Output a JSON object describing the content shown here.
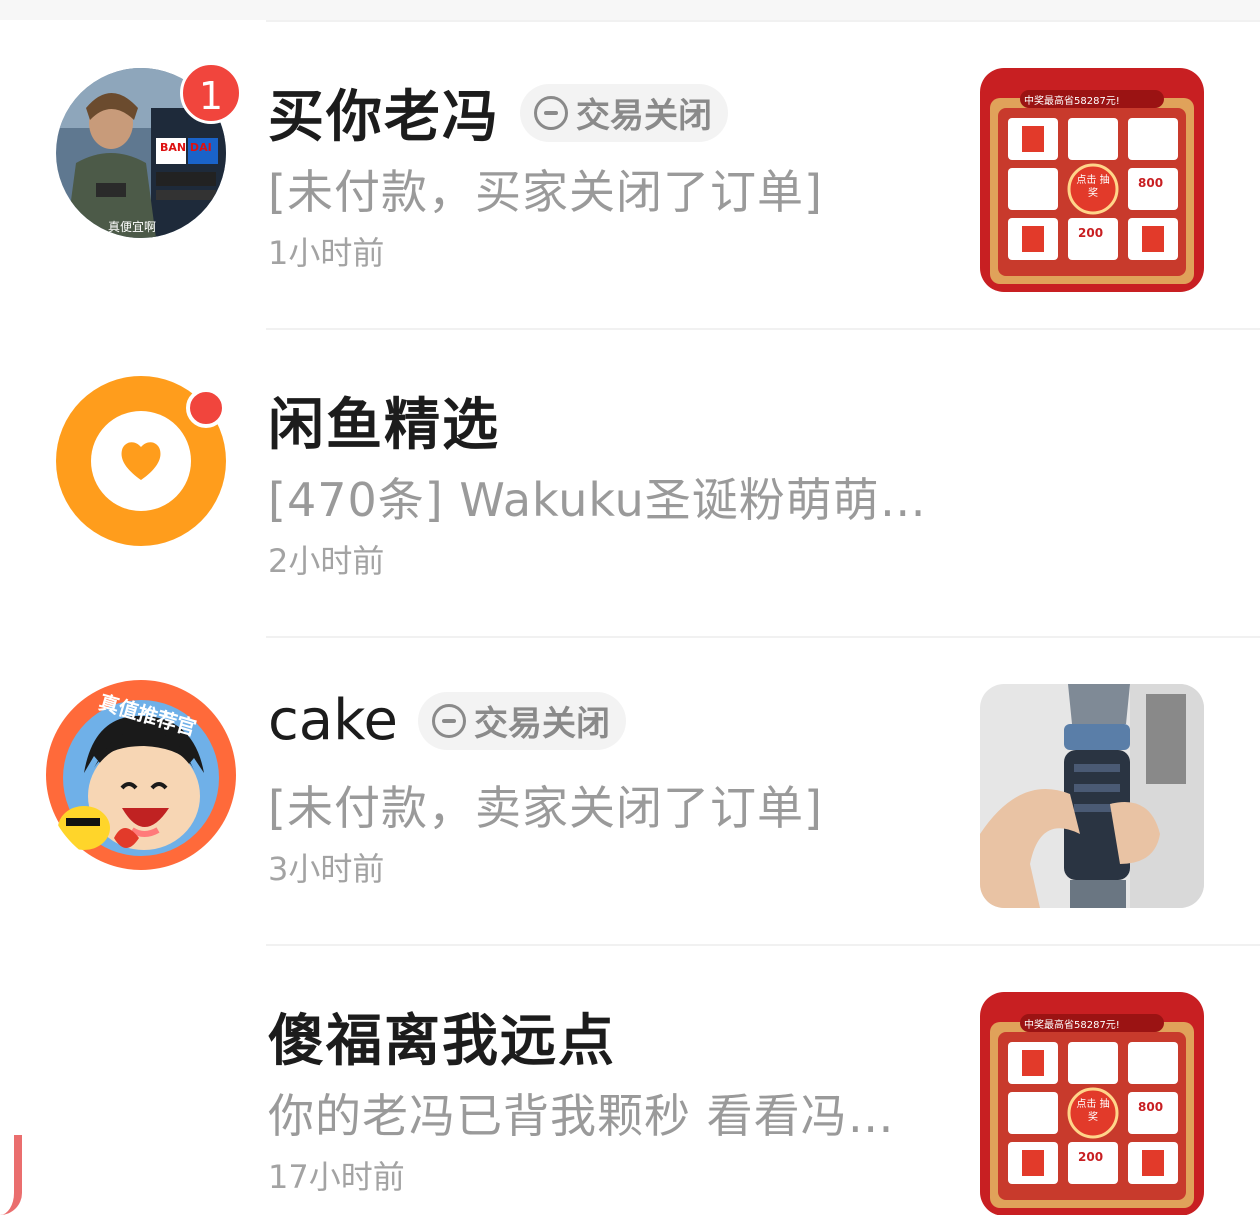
{
  "conversations": [
    {
      "name": "买你老冯",
      "status": "交易关闭",
      "preview": "[未付款，买家关闭了订单]",
      "time": "1小时前",
      "unread_count": "1",
      "avatar_text": {
        "brand": "BAN DAI",
        "caption": "真便宜啊"
      },
      "thumbnail_text": {
        "banner": "中奖最高省58287元!",
        "center": "点击 抽奖",
        "value_a": "800",
        "value_b": "200"
      }
    },
    {
      "name": "闲鱼精选",
      "status": "",
      "preview": "[470条] Wakuku圣诞粉萌萌…",
      "time": "2小时前",
      "unread_dot": true
    },
    {
      "name": "cake",
      "status": "交易关闭",
      "preview": "[未付款，卖家关闭了订单]",
      "time": "3小时前",
      "avatar_text": {
        "arc": "真值推荐官"
      }
    },
    {
      "name": "傻福离我远点",
      "status": "",
      "preview": "你的老冯已背我颗秒 看看冯…",
      "time": "17小时前",
      "thumbnail_text": {
        "banner": "中奖最高省58287元!",
        "center": "点击 抽奖",
        "value_a": "800",
        "value_b": "200"
      }
    }
  ],
  "colors": {
    "badge": "#f1453d",
    "xianyu_orange": "#ff9d1c",
    "name_text": "#1c1c1c",
    "secondary_text": "#9a9a9a",
    "divider": "#f1f1f1"
  },
  "icons": {
    "status": "minus-circle-icon",
    "xianyu": "heart-icon"
  }
}
